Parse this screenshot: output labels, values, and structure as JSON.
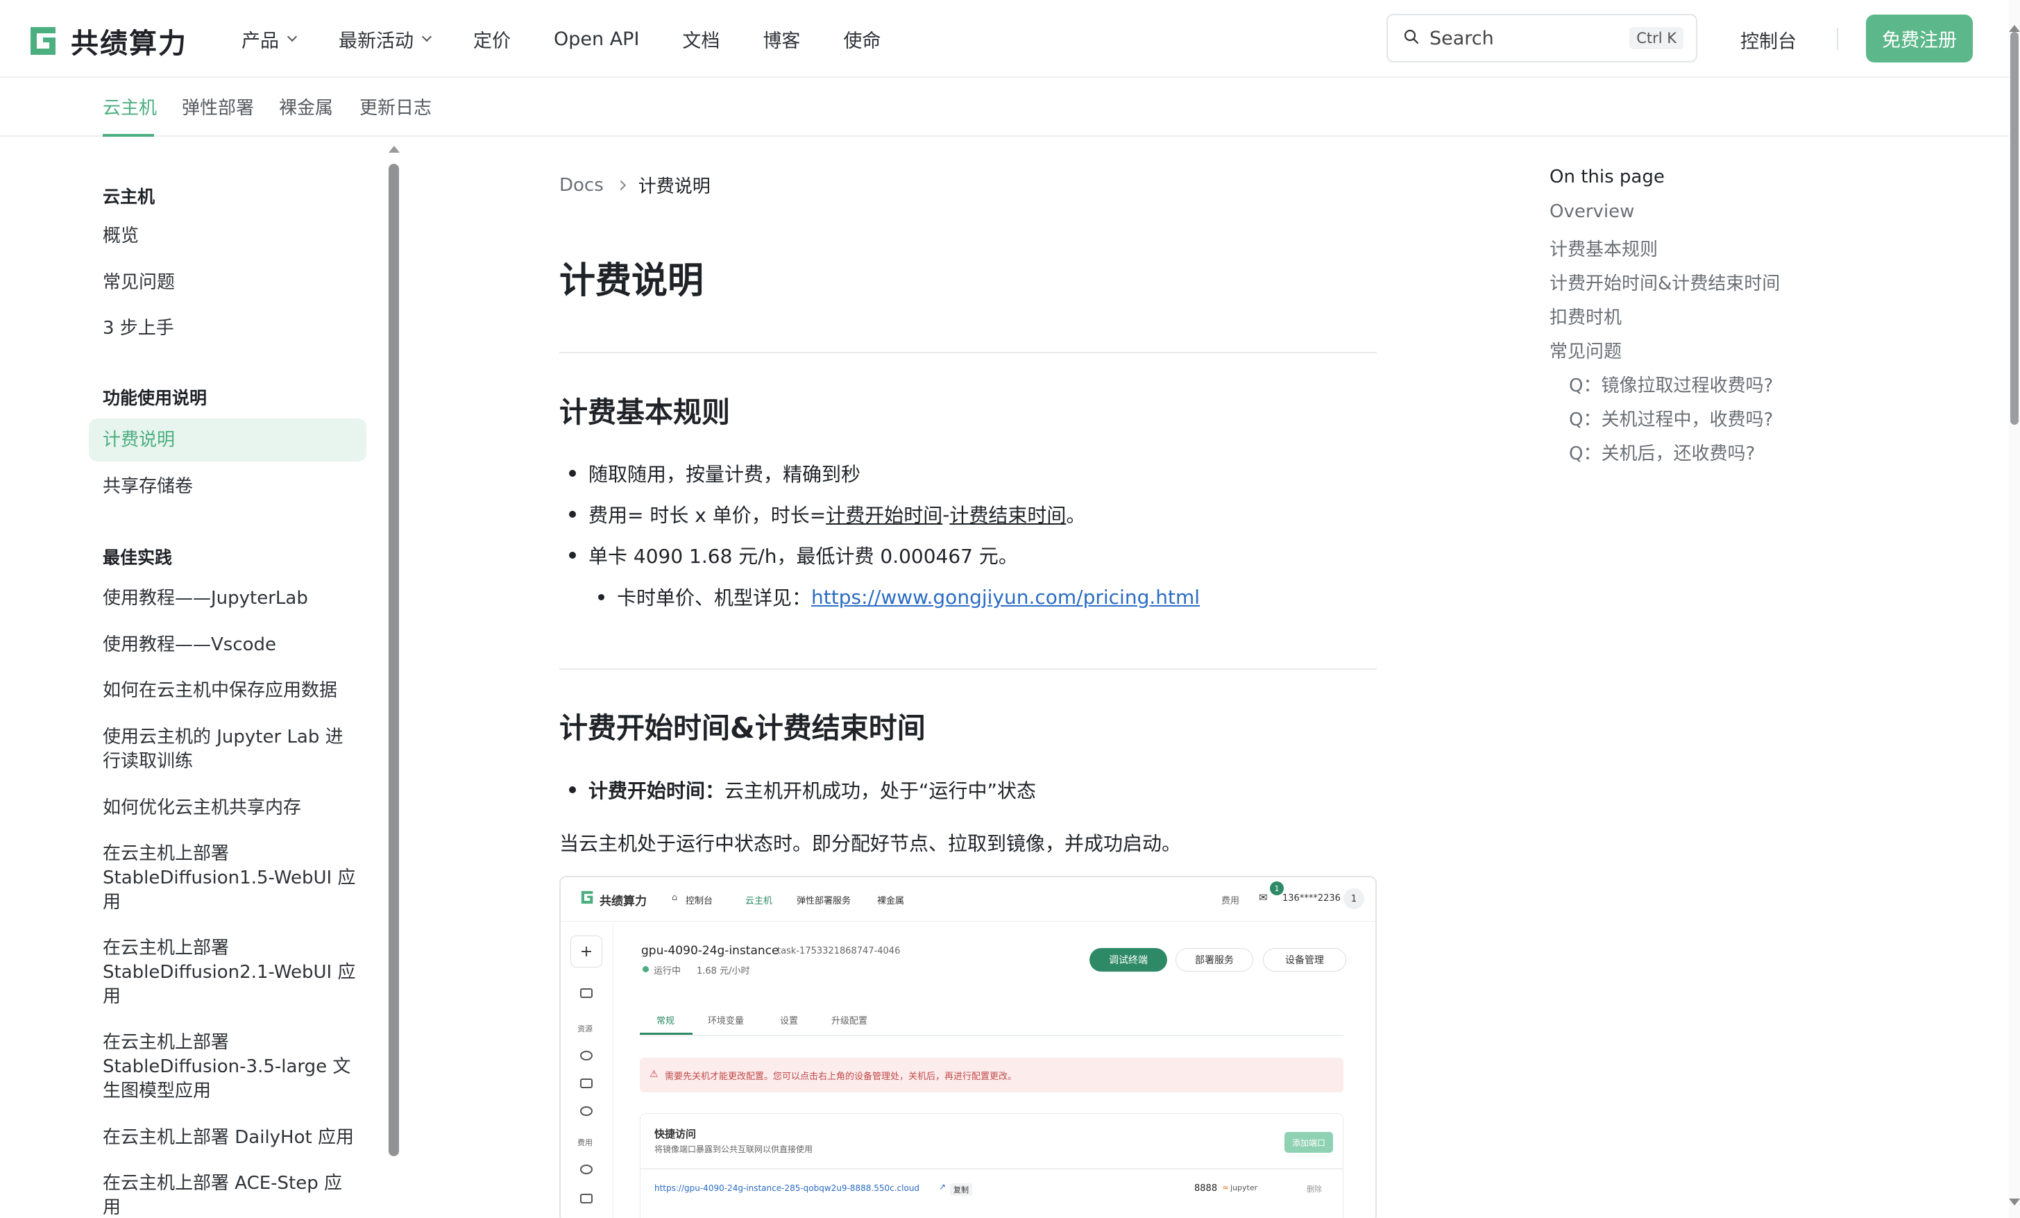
{
  "brand": {
    "name": "共绩算力",
    "accent": "#4caf80",
    "signup_color": "#5cb88a"
  },
  "topnav": {
    "items": [
      {
        "label": "产品",
        "dropdown": true
      },
      {
        "label": "最新活动",
        "dropdown": true
      },
      {
        "label": "定价",
        "dropdown": false
      },
      {
        "label": "Open API",
        "dropdown": false
      },
      {
        "label": "文档",
        "dropdown": false
      },
      {
        "label": "博客",
        "dropdown": false
      },
      {
        "label": "使命",
        "dropdown": false
      }
    ],
    "search_placeholder": "Search",
    "search_shortcut": "Ctrl K",
    "console_label": "控制台",
    "signup_label": "免费注册"
  },
  "subnav": {
    "tabs": [
      "云主机",
      "弹性部署",
      "裸金属",
      "更新日志"
    ],
    "active": "云主机"
  },
  "sidebar": {
    "sections": [
      {
        "title": "云主机",
        "items": [
          "概览",
          "常见问题",
          "3 步上手"
        ]
      },
      {
        "title": "功能使用说明",
        "items": [
          "计费说明",
          "共享存储卷"
        ]
      },
      {
        "title": "最佳实践",
        "items": [
          "使用教程——JupyterLab",
          "使用教程——Vscode",
          "如何在云主机中保存应用数据",
          "使用云主机的 Jupyter Lab 进行读取训练",
          "如何优化云主机共享内存",
          "在云主机上部署 StableDiffusion1.5-WebUI 应用",
          "在云主机上部署 StableDiffusion2.1-WebUI 应用",
          "在云主机上部署 StableDiffusion-3.5-large 文生图模型应用",
          "在云主机上部署 DailyHot 应用",
          "在云主机上部署 ACE-Step 应用"
        ]
      }
    ],
    "active_item": "计费说明"
  },
  "doc": {
    "breadcrumb_root": "Docs",
    "breadcrumb_current": "计费说明",
    "title": "计费说明",
    "sec1": {
      "heading": "计费基本规则",
      "b1": "随取随用，按量计费，精确到秒",
      "b2_pre": "费用= 时长 x 单价，时长=",
      "b2_link1": "计费开始时间",
      "b2_dash": "-",
      "b2_link2": "计费结束时间",
      "b2_end": "。",
      "b3": "单卡 4090 1.68 元/h，最低计费 0.000467 元。",
      "b4_pre": "卡时单价、机型详见：",
      "b4_link": "https://www.gongjiyun.com/pricing.html"
    },
    "sec2": {
      "heading": "计费开始时间&计费结束时间",
      "b1_bold": "计费开始时间：",
      "b1_rest": "云主机开机成功，处于“运行中”状态",
      "para": "当云主机处于运行中状态时。即分配好节点、拉取到镜像，并成功启动。"
    },
    "screenshot": {
      "brand": "共绩算力",
      "nav": [
        "控制台",
        "云主机",
        "弹性部署服务",
        "裸金属"
      ],
      "right": [
        "费用",
        "136****2236",
        "1"
      ],
      "badge": "1",
      "instance_name": "gpu-4090-24g-instance",
      "task_id": "task-1753321868747-4046",
      "status": "运行中",
      "price": "1.68 元/小时",
      "btn_terminal": "调试终端",
      "btn_deploy": "部署服务",
      "btn_manage": "设备管理",
      "tabs": [
        "常规",
        "环境变量",
        "设置",
        "升级配置"
      ],
      "side_labels": [
        "资源",
        "费用"
      ],
      "warning": "需要先关机才能更改配置。您可以点击右上角的设备管理处，关机后，再进行配置更改。",
      "card_title": "快捷访问",
      "card_sub": "将镜像端口暴露到公共互联网以供直接使用",
      "card_btn": "添加端口",
      "url": "https://gpu-4090-24g-instance-285-qobqw2u9-8888.550c.cloud",
      "copy": "复制",
      "port": "8888",
      "app": "jupyter",
      "del": "删除"
    }
  },
  "toc": {
    "title": "On this page",
    "items": [
      {
        "label": "Overview",
        "indent": false
      },
      {
        "label": "计费基本规则",
        "indent": false
      },
      {
        "label": "计费开始时间&计费结束时间",
        "indent": false
      },
      {
        "label": "扣费时机",
        "indent": false
      },
      {
        "label": "常见问题",
        "indent": false
      },
      {
        "label": "Q：镜像拉取过程收费吗?",
        "indent": true
      },
      {
        "label": "Q：关机过程中，收费吗?",
        "indent": true
      },
      {
        "label": "Q：关机后，还收费吗?",
        "indent": true
      }
    ]
  }
}
